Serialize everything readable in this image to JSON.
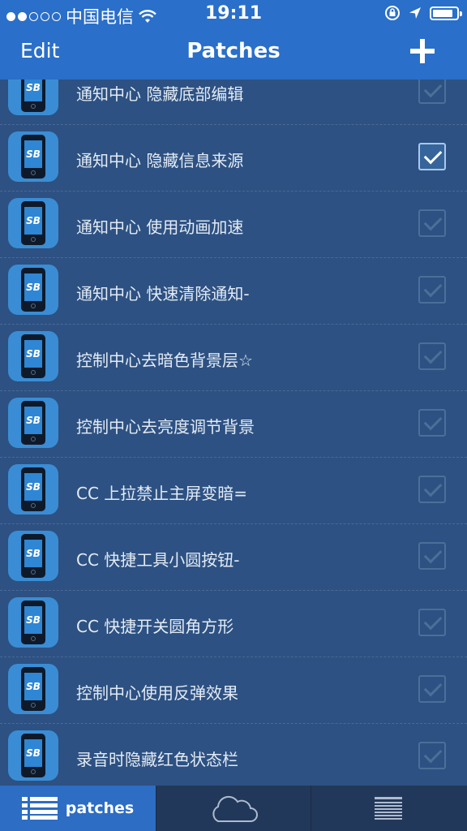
{
  "status_bar": {
    "carrier": "中国电信",
    "time": "19:11",
    "battery_level": 0.85
  },
  "nav": {
    "edit_label": "Edit",
    "title": "Patches"
  },
  "patches": [
    {
      "icon_text": "SB",
      "label": "通知中心 隐藏底部编辑",
      "enabled": false
    },
    {
      "icon_text": "SB",
      "label": "通知中心 隐藏信息来源",
      "enabled": true
    },
    {
      "icon_text": "SB",
      "label": "通知中心 使用动画加速",
      "enabled": false
    },
    {
      "icon_text": "SB",
      "label": "通知中心 快速清除通知-",
      "enabled": false
    },
    {
      "icon_text": "SB",
      "label": "控制中心去暗色背景层☆",
      "enabled": false
    },
    {
      "icon_text": "SB",
      "label": "控制中心去亮度调节背景",
      "enabled": false
    },
    {
      "icon_text": "SB",
      "label": "CC 上拉禁止主屏变暗=",
      "enabled": false
    },
    {
      "icon_text": "SB",
      "label": "CC 快捷工具小圆按钮-",
      "enabled": false
    },
    {
      "icon_text": "SB",
      "label": "CC 快捷开关圆角方形",
      "enabled": false
    },
    {
      "icon_text": "SB",
      "label": "控制中心使用反弹效果",
      "enabled": false
    },
    {
      "icon_text": "SB",
      "label": "录音时隐藏红色状态栏",
      "enabled": false
    }
  ],
  "tab_bar": {
    "tabs": [
      {
        "label": "patches",
        "icon": "list-icon",
        "selected": true
      },
      {
        "label": "",
        "icon": "cloud-icon",
        "selected": false
      },
      {
        "label": "",
        "icon": "news-icon",
        "selected": false
      }
    ]
  },
  "colors": {
    "nav_blue": "#2a6fc9",
    "list_bg": "#2d5182",
    "tab_bar_bg": "#22385a",
    "selected_tab_bg": "#2d6dc4"
  }
}
